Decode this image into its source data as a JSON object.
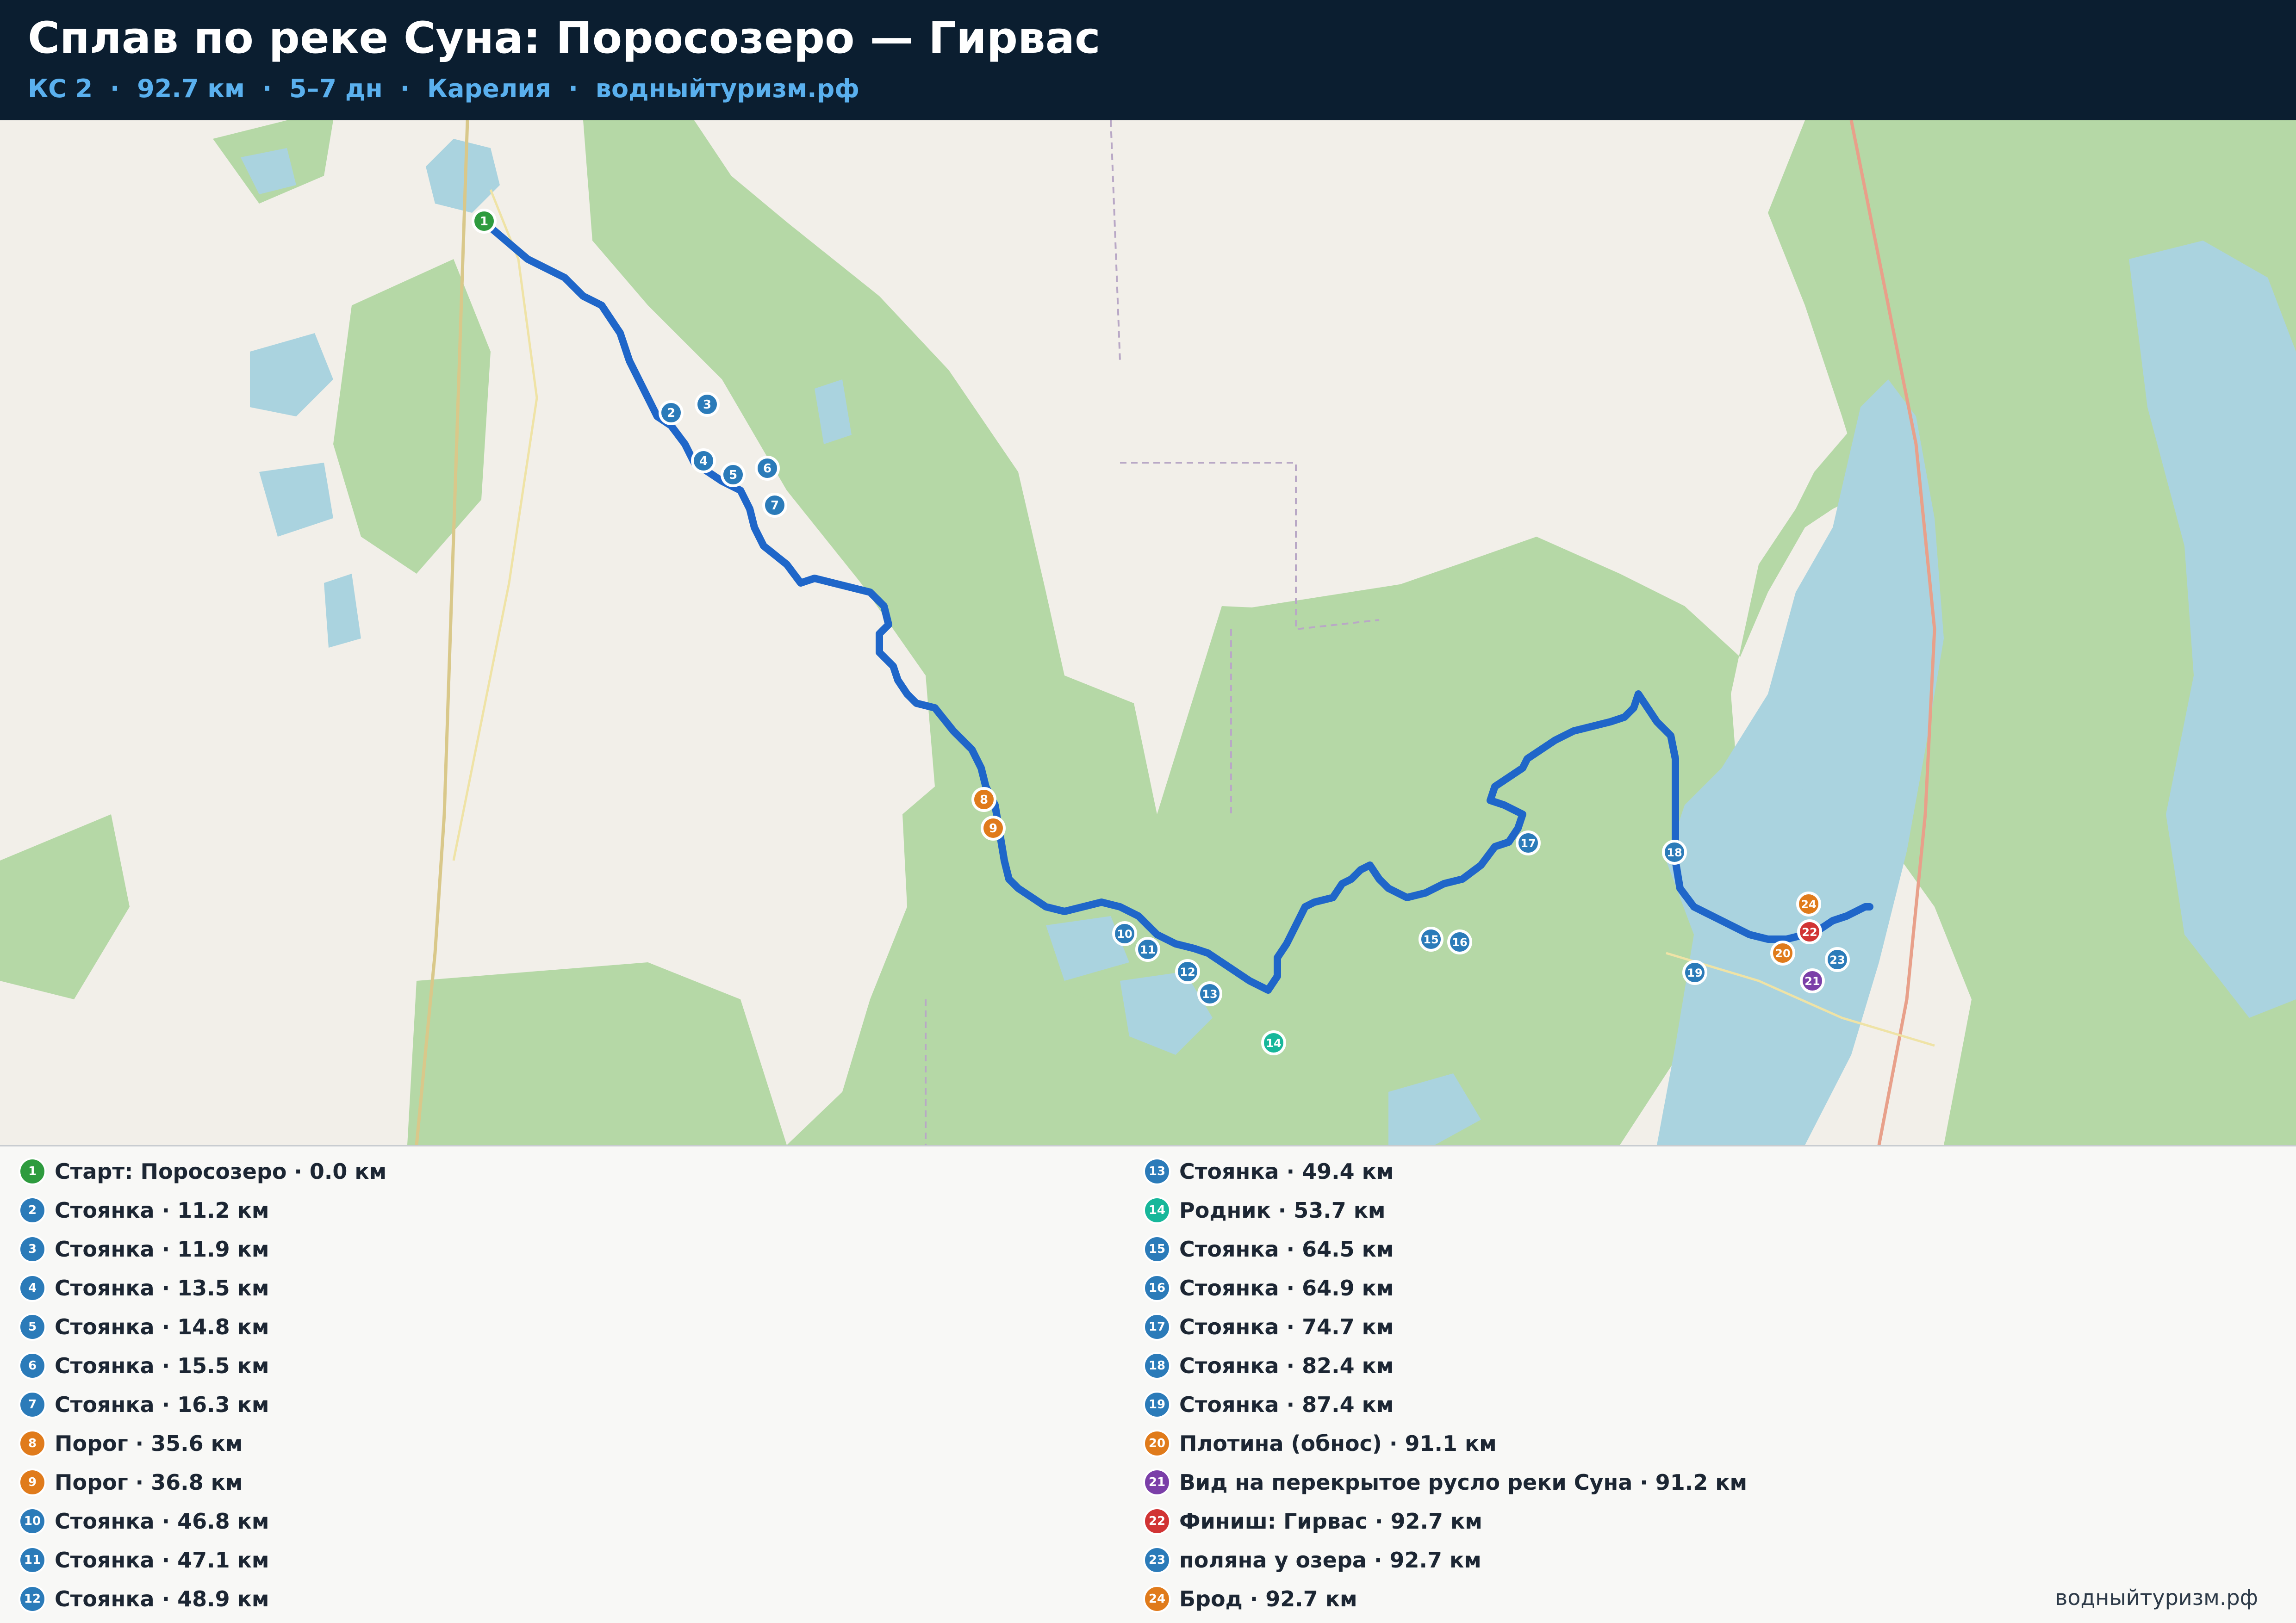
{
  "header": {
    "title": "Сплав по реке Суна: Поросозеро — Гирвас",
    "subtitle_parts": [
      "КС 2",
      "92.7 км",
      "5–7 дн",
      "Карелия",
      "водныйтуризм.рф"
    ],
    "subtitle_separator": "·"
  },
  "colors": {
    "header_bg": "#0b1e30",
    "route_line": "#1f66c9",
    "forest": "#aed3a0",
    "water": "#aad3df",
    "land": "#f2efe9",
    "camp": "#2b7bb9",
    "rapid": "#e07b1b",
    "start": "#2e9b3e",
    "finish": "#d13434",
    "spring": "#17b79a",
    "viewpoint": "#7b3fa8"
  },
  "markers": [
    {
      "n": "1",
      "type": "start",
      "label": "Старт: Поросозеро · 0.0 км"
    },
    {
      "n": "2",
      "type": "camp",
      "label": "Стоянка · 11.2 км"
    },
    {
      "n": "3",
      "type": "camp",
      "label": "Стоянка · 11.9 км"
    },
    {
      "n": "4",
      "type": "camp",
      "label": "Стоянка · 13.5 км"
    },
    {
      "n": "5",
      "type": "camp",
      "label": "Стоянка · 14.8 км"
    },
    {
      "n": "6",
      "type": "camp",
      "label": "Стоянка · 15.5 км"
    },
    {
      "n": "7",
      "type": "camp",
      "label": "Стоянка · 16.3 км"
    },
    {
      "n": "8",
      "type": "rapid",
      "label": "Порог · 35.6 км"
    },
    {
      "n": "9",
      "type": "rapid",
      "label": "Порог · 36.8 км"
    },
    {
      "n": "10",
      "type": "camp",
      "label": "Стоянка · 46.8 км"
    },
    {
      "n": "11",
      "type": "camp",
      "label": "Стоянка · 47.1 км"
    },
    {
      "n": "12",
      "type": "camp",
      "label": "Стоянка · 48.9 км"
    },
    {
      "n": "13",
      "type": "camp",
      "label": "Стоянка · 49.4 км"
    },
    {
      "n": "14",
      "type": "spring",
      "label": "Родник · 53.7 км"
    },
    {
      "n": "15",
      "type": "camp",
      "label": "Стоянка · 64.5 км"
    },
    {
      "n": "16",
      "type": "camp",
      "label": "Стоянка · 64.9 км"
    },
    {
      "n": "17",
      "type": "camp",
      "label": "Стоянка · 74.7 км"
    },
    {
      "n": "18",
      "type": "camp",
      "label": "Стоянка · 82.4 км"
    },
    {
      "n": "19",
      "type": "camp",
      "label": "Стоянка · 87.4 км"
    },
    {
      "n": "20",
      "type": "rapid",
      "label": "Плотина (обнос) · 91.1 км"
    },
    {
      "n": "21",
      "type": "viewpoint",
      "label": "Вид на перекрытое русло реки Суна · 91.2 км"
    },
    {
      "n": "22",
      "type": "finish",
      "label": "Финиш: Гирвас · 92.7 км"
    },
    {
      "n": "23",
      "type": "camp",
      "label": "поляна у озера · 92.7 км"
    },
    {
      "n": "24",
      "type": "rapid",
      "label": "Брод · 92.7 км"
    }
  ],
  "footer": {
    "site": "водныйтуризм.рф"
  }
}
